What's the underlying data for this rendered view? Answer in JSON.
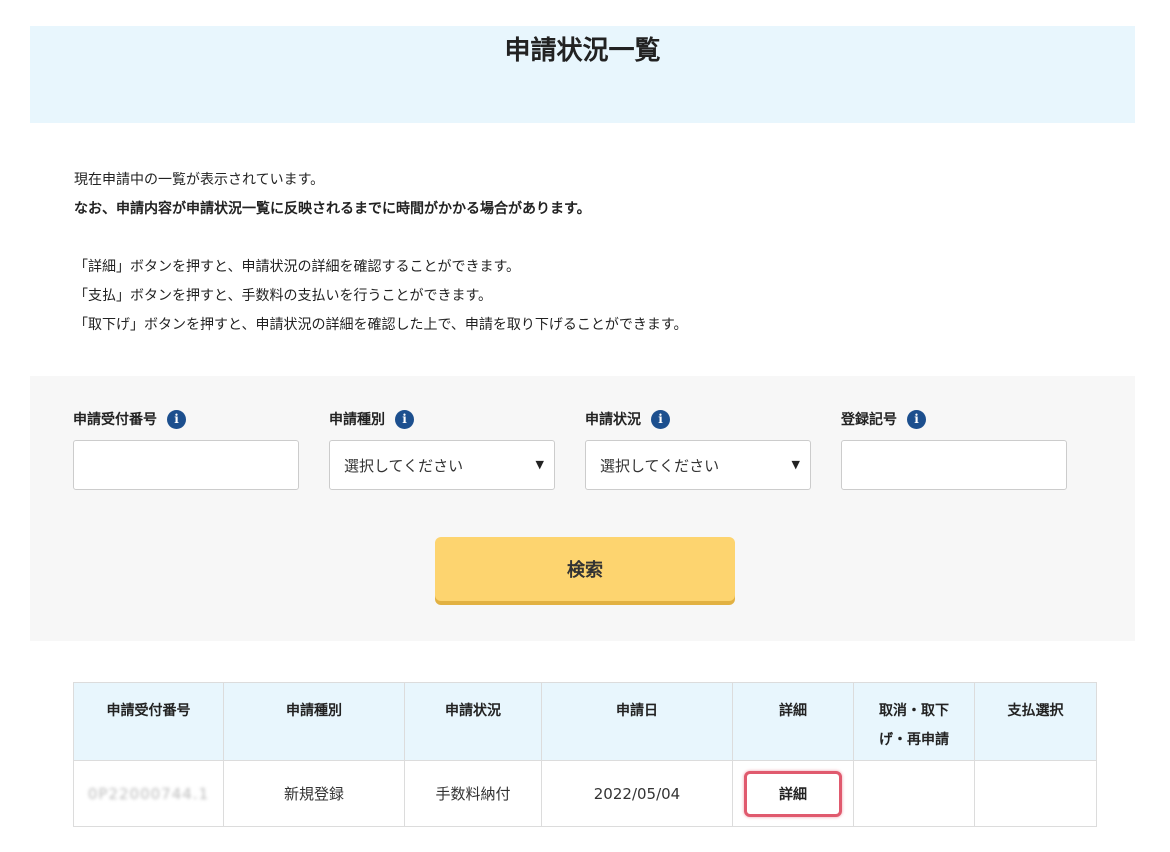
{
  "header": {
    "title": "申請状況一覧"
  },
  "intro": {
    "line1": "現在申請中の一覧が表示されています。",
    "line2": "なお、申請内容が申請状況一覧に反映されるまでに時間がかかる場合があります。",
    "line3": "「詳細」ボタンを押すと、申請状況の詳細を確認することができます。",
    "line4": "「支払」ボタンを押すと、手数料の支払いを行うことができます。",
    "line5": "「取下げ」ボタンを押すと、申請状況の詳細を確認した上で、申請を取り下げることができます。"
  },
  "search": {
    "fields": [
      {
        "label": "申請受付番号",
        "type": "text",
        "value": ""
      },
      {
        "label": "申請種別",
        "type": "select",
        "value": "選択してください"
      },
      {
        "label": "申請状況",
        "type": "select",
        "value": "選択してください"
      },
      {
        "label": "登録記号",
        "type": "text",
        "value": ""
      }
    ],
    "info_icon_glyph": "i",
    "select_arrow": "▼",
    "button_label": "検索"
  },
  "table": {
    "headers": [
      "申請受付番号",
      "申請種別",
      "申請状況",
      "申請日",
      "詳細",
      "取消・取下げ・再申請",
      "支払選択"
    ],
    "rows": [
      {
        "receipt_number": "0P22000744.1",
        "type": "新規登録",
        "status": "手数料納付",
        "date": "2022/05/04",
        "detail_button": "詳細",
        "cancel": "",
        "payment": ""
      }
    ]
  },
  "colors": {
    "header_band": "#e8f6fd",
    "search_button": "#fdd46f",
    "info_icon": "#1c4f8e",
    "detail_highlight": "#e05a6e"
  }
}
